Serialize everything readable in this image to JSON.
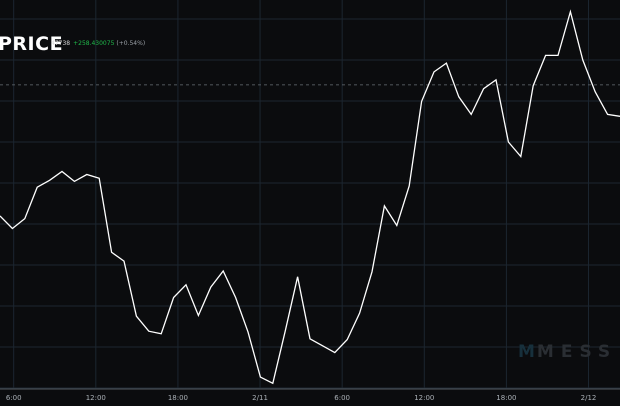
{
  "header": {
    "title": "PRICE",
    "price": "47738",
    "change": "+258.430075",
    "change_pct": "(+0.54%)"
  },
  "watermark": {
    "logo": "M",
    "text": "MESS"
  },
  "colors": {
    "background": "#0b0c0e",
    "grid": "#1c2630",
    "line": "#ffffff",
    "positive": "#1fb84a",
    "axis": "#555a60"
  },
  "chart_data": {
    "type": "line",
    "title": "PRICE",
    "xlabel": "",
    "ylabel": "",
    "x_tick_labels": [
      "6:00",
      "12:00",
      "18:00",
      "2/11",
      "6:00",
      "12:00",
      "18:00",
      "2/12"
    ],
    "x_ticks_hours": [
      6,
      12,
      18,
      24,
      30,
      36,
      42,
      48
    ],
    "xlim_hours": [
      5,
      50.3
    ],
    "ylim": [
      0,
      100
    ],
    "reference_value": 79.4,
    "grid": true,
    "series": [
      {
        "name": "price",
        "x_hours": [
          5,
          5.5,
          6.4,
          7.4,
          8.4,
          9.4,
          10.3,
          11.3,
          12.2,
          13.2,
          14.1,
          15.1,
          16.1,
          17,
          18,
          18.9,
          19.9,
          20.8,
          21.8,
          22.8,
          23.7,
          24.7,
          25.6,
          26.6,
          27.5,
          28.5,
          29.4,
          30.4,
          31.4,
          32.3,
          33.3,
          34.2,
          35.2,
          36.1,
          37.1,
          38.1,
          39,
          40,
          40.9,
          41.9,
          42.8,
          43.8,
          44.7,
          45.7,
          46.7,
          47.6,
          48.6,
          49.5,
          50.3
        ],
        "values": [
          45.2,
          41.9,
          44.5,
          52.7,
          54.5,
          56.8,
          54.2,
          56,
          55,
          35.7,
          33.4,
          19,
          15.1,
          14.4,
          23.9,
          27.2,
          19.2,
          26.6,
          30.8,
          23.9,
          14.9,
          3.1,
          1.5,
          15.1,
          29.3,
          13.1,
          11.3,
          9.5,
          12.9,
          19.8,
          30.6,
          47.8,
          42.7,
          53,
          75.1,
          82.8,
          85.1,
          76.3,
          71.7,
          78.4,
          80.7,
          64.5,
          60.7,
          79.2,
          87.1,
          87.1,
          98.5,
          85.9,
          77.6,
          71.7,
          71.2
        ]
      }
    ]
  }
}
